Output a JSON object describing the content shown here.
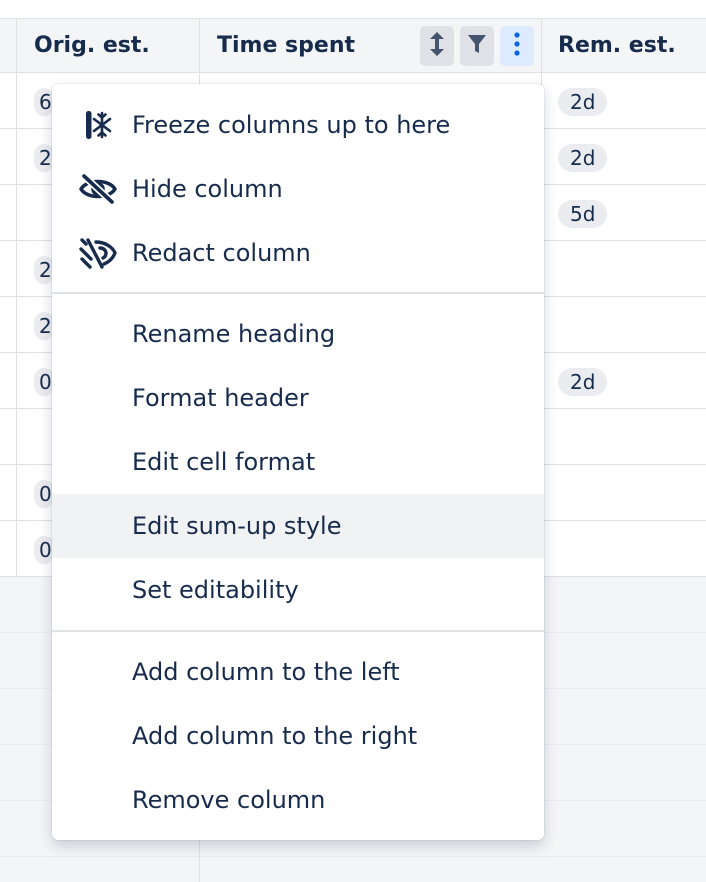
{
  "header": {
    "columns": [
      {
        "label": "Orig. est."
      },
      {
        "label": "Time spent"
      },
      {
        "label": "Rem. est."
      }
    ],
    "buttons": {
      "sort_icon": "sort-vertical-icon",
      "filter_icon": "filter-icon",
      "more_icon": "more-vertical-icon"
    }
  },
  "table": {
    "orig_est_partial": [
      "6",
      "2",
      "",
      "2",
      "2",
      "0",
      "",
      "0",
      "0"
    ],
    "rem_est": [
      "2d",
      "2d",
      "5d",
      "",
      "",
      "2d",
      "",
      "",
      ""
    ]
  },
  "menu": {
    "groups": [
      [
        {
          "label": "Freeze columns up to here",
          "icon": "freeze-icon"
        },
        {
          "label": "Hide column",
          "icon": "eye-off-icon"
        },
        {
          "label": "Redact column",
          "icon": "redact-icon"
        }
      ],
      [
        {
          "label": "Rename heading"
        },
        {
          "label": "Format header"
        },
        {
          "label": "Edit cell format"
        },
        {
          "label": "Edit sum-up style",
          "highlighted": true
        },
        {
          "label": "Set editability"
        }
      ],
      [
        {
          "label": "Add column to the left"
        },
        {
          "label": "Add column to the right"
        },
        {
          "label": "Remove column"
        }
      ]
    ]
  },
  "colors": {
    "header_bg": "#f4f5f7",
    "text": "#172b4d",
    "chip_bg": "#ebecf0",
    "active_button_bg": "#deebff",
    "active_icon": "#0c66e4",
    "hover_bg": "#f1f2f4"
  }
}
